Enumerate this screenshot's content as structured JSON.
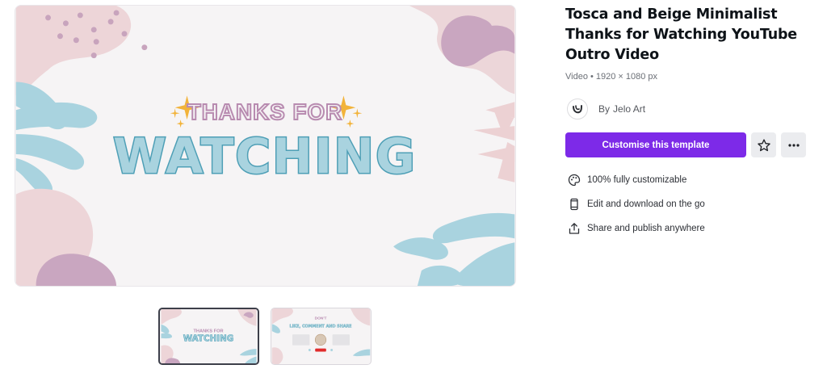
{
  "template": {
    "title": "Tosca and Beige Minimalist Thanks for Watching YouTube Outro Video",
    "meta": "Video • 1920 × 1080 px",
    "author_prefix": "By",
    "author_name": "Jelo Art",
    "cta_label": "Customise this template",
    "features": [
      {
        "icon": "palette-icon",
        "label": "100% fully customizable"
      },
      {
        "icon": "mobile-phone-icon",
        "label": "Edit and download on the go"
      },
      {
        "icon": "share-upload-icon",
        "label": "Share and publish anywhere"
      }
    ]
  },
  "preview": {
    "headline_small": "THANKS FOR",
    "headline_big": "WATCHING"
  },
  "thumbnails": [
    {
      "name": "page-1",
      "line1": "THANKS FOR",
      "line2": "WATCHING",
      "selected": true
    },
    {
      "name": "page-2",
      "line1": "DON'T",
      "line2": "LIKE, COMMENT AND SHARE",
      "selected": false
    }
  ],
  "colors": {
    "accent": "#7d2ae8",
    "pink": "#e6c8cc",
    "mauve": "#c9a6c0",
    "tosca": "#a9d3df",
    "gold": "#f2b33a"
  }
}
